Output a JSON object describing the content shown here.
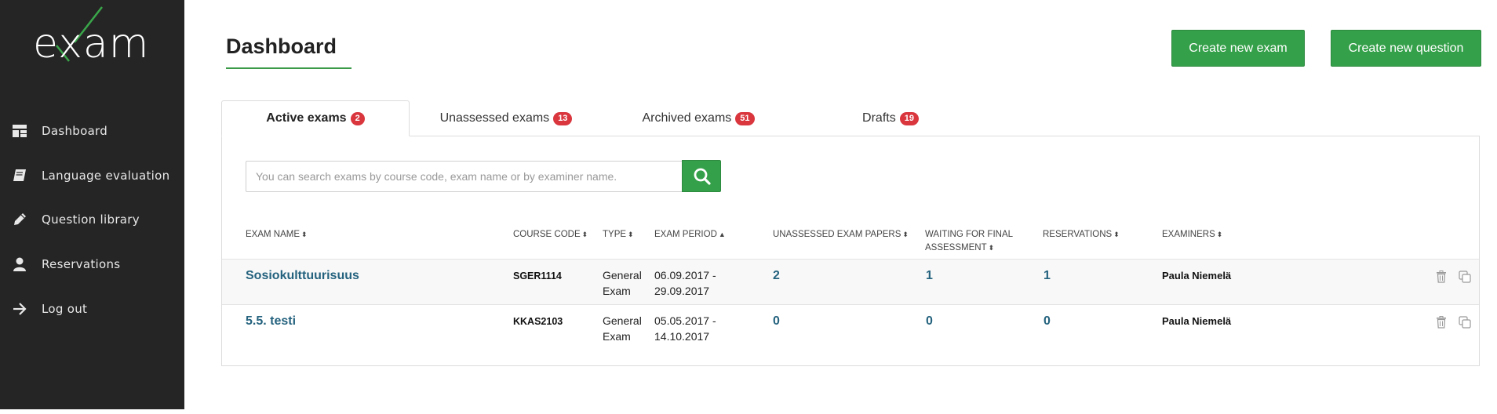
{
  "app": {
    "logo_text": "exam"
  },
  "sidebar": {
    "items": [
      {
        "label": "Dashboard",
        "icon": "dashboard-icon"
      },
      {
        "label": "Language evaluation",
        "icon": "book-icon"
      },
      {
        "label": "Question library",
        "icon": "pencil-icon"
      },
      {
        "label": "Reservations",
        "icon": "user-icon"
      },
      {
        "label": "Log out",
        "icon": "arrow-right-icon"
      }
    ]
  },
  "header": {
    "title": "Dashboard",
    "create_exam_label": "Create new exam",
    "create_question_label": "Create new question"
  },
  "tabs": [
    {
      "label": "Active exams",
      "count": "2"
    },
    {
      "label": "Unassessed exams",
      "count": "13"
    },
    {
      "label": "Archived exams",
      "count": "51"
    },
    {
      "label": "Drafts",
      "count": "19"
    }
  ],
  "search": {
    "placeholder": "You can search exams by course code, exam name or by examiner name.",
    "value": ""
  },
  "table": {
    "columns": {
      "exam_name": "EXAM NAME",
      "course_code": "COURSE CODE",
      "type": "TYPE",
      "exam_period": "EXAM PERIOD",
      "unassessed": "UNASSESSED EXAM PAPERS",
      "waiting_line1": "WAITING FOR FINAL",
      "waiting_line2": "ASSESSMENT",
      "reservations": "RESERVATIONS",
      "examiners": "EXAMINERS"
    },
    "rows": [
      {
        "name": "Sosiokulttuurisuus",
        "course_code": "SGER1114",
        "type_line1": "General",
        "type_line2": "Exam",
        "period_line1": "06.09.2017 -",
        "period_line2": "29.09.2017",
        "unassessed": "2",
        "waiting": "1",
        "reservations": "1",
        "examiners": "Paula Niemelä"
      },
      {
        "name": "5.5. testi",
        "course_code": "KKAS2103",
        "type_line1": "General",
        "type_line2": "Exam",
        "period_line1": "05.05.2017 -",
        "period_line2": "14.10.2017",
        "unassessed": "0",
        "waiting": "0",
        "reservations": "0",
        "examiners": "Paula Niemelä"
      }
    ]
  },
  "colors": {
    "sidebar_bg": "#252525",
    "accent_green": "#35a04a",
    "badge_red": "#d9363e",
    "link_blue": "#24627e"
  }
}
